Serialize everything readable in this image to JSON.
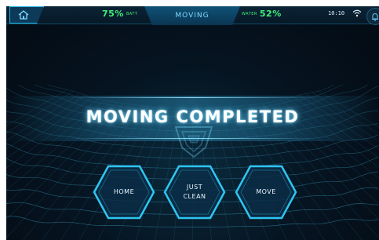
{
  "topbar": {
    "battery_value": "75%",
    "battery_label": "BATT",
    "status": "MOVING",
    "water_label": "WATER",
    "water_value": "52%",
    "time": "10:10",
    "home_icon": "home-icon",
    "wifi_icon": "wifi-icon",
    "bell_icon": "bell-icon"
  },
  "main": {
    "title": "MOVING COMPLETED",
    "emblem_icon": "robot-emblem-icon"
  },
  "actions": [
    {
      "label": "HOME"
    },
    {
      "label": "JUST\nCLEAN"
    },
    {
      "label": "MOVE"
    }
  ],
  "colors": {
    "accent": "#1fb6e6",
    "status_green": "#3ff07a",
    "background": "#061421"
  }
}
